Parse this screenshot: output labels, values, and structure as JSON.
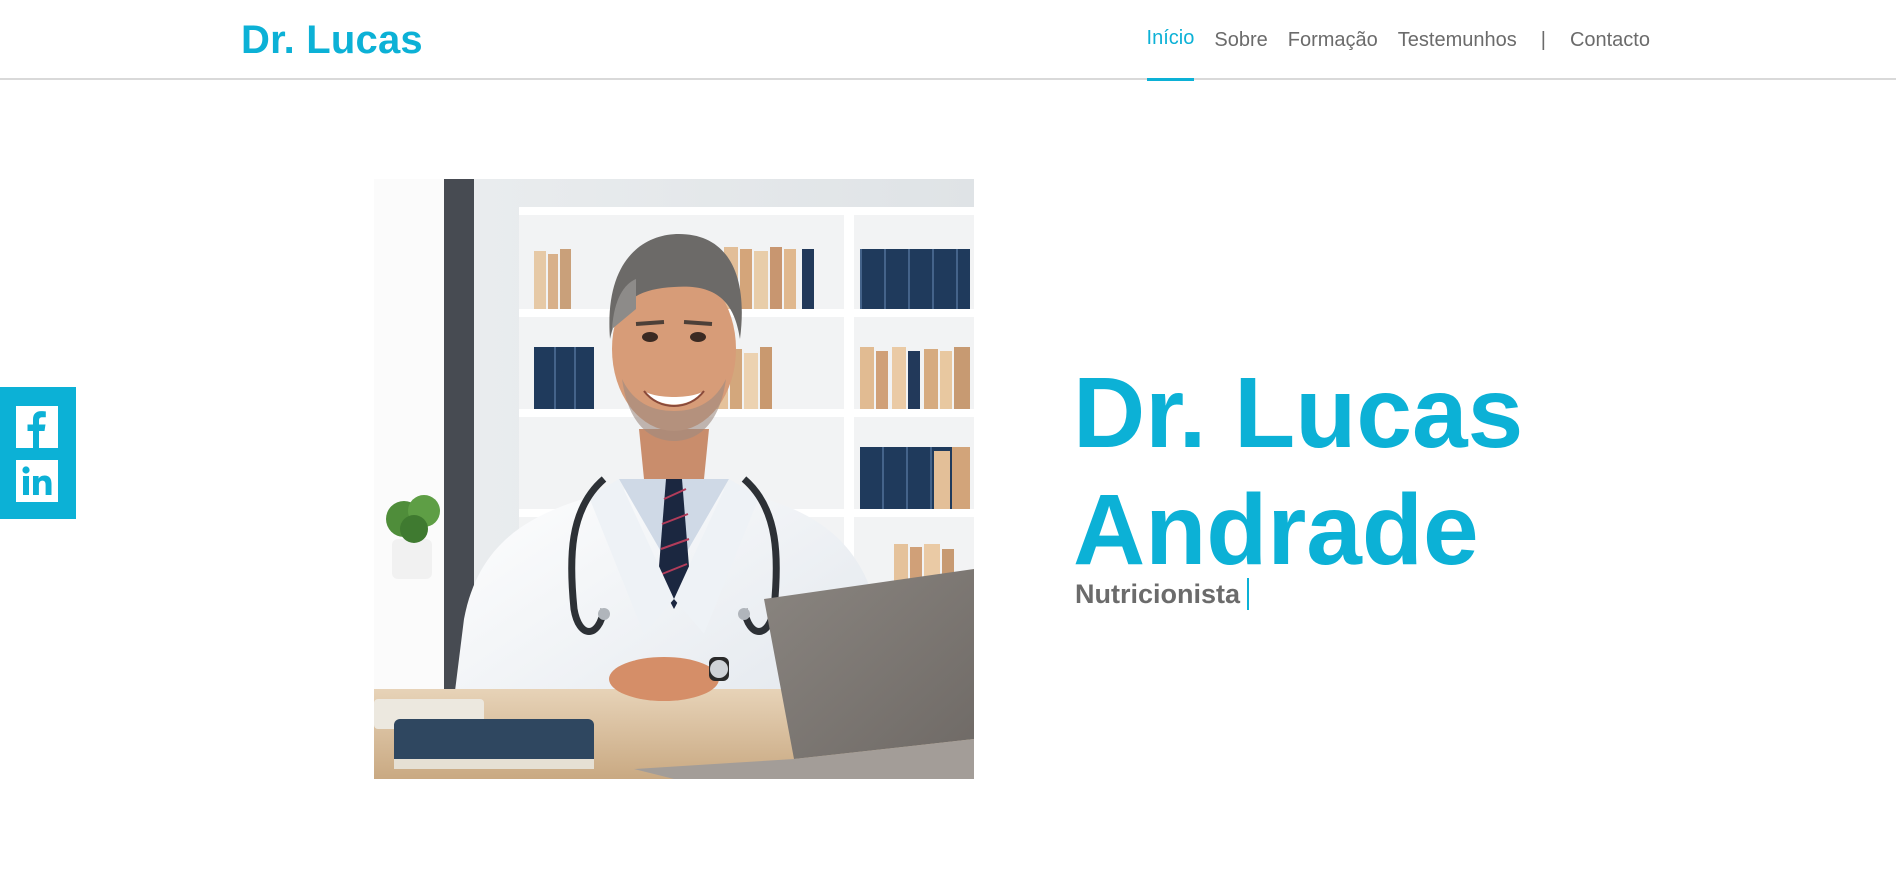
{
  "header": {
    "brand": "Dr. Lucas",
    "nav": [
      {
        "label": "Início",
        "active": true
      },
      {
        "label": "Sobre"
      },
      {
        "label": "Formação"
      },
      {
        "label": "Testemunhos"
      }
    ],
    "separator": "|",
    "contact_label": "Contacto"
  },
  "social": {
    "items": [
      {
        "icon": "facebook-icon"
      },
      {
        "icon": "linkedin-icon"
      }
    ]
  },
  "hero": {
    "name_line1": "Dr. Lucas",
    "name_line2": "Andrade",
    "role": "Nutricionista"
  },
  "colors": {
    "accent": "#0cb1d6",
    "text_muted": "#6b6b6b",
    "divider": "#d9d9d9"
  }
}
